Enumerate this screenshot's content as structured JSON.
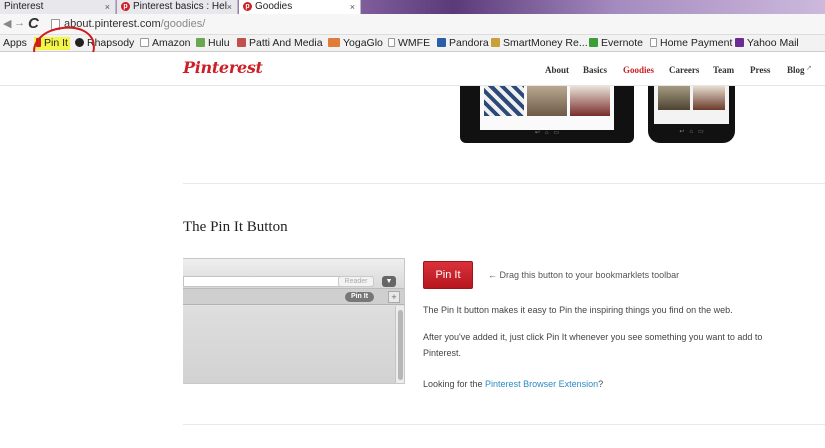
{
  "browser": {
    "tabs": [
      {
        "title": "Pinterest",
        "active": false
      },
      {
        "title": "Pinterest basics : Hel",
        "active": false
      },
      {
        "title": "Goodies",
        "active": true
      }
    ],
    "close_glyph": "×",
    "url_host": "about.pinterest.com",
    "url_path": "/goodies/",
    "bookmarks": [
      {
        "label": "Apps",
        "icon": "apps-icon",
        "color": "#4a7bd0"
      },
      {
        "label": "Pin It",
        "icon": "pin-icon",
        "color": "#cb2027",
        "highlighted": true
      },
      {
        "label": "Rhapsody",
        "icon": "rhapsody-icon",
        "color": "#222222"
      },
      {
        "label": "Amazon",
        "icon": "amazon-icon",
        "color": "#222222"
      },
      {
        "label": "Hulu",
        "icon": "hulu-icon",
        "color": "#6aa84f"
      },
      {
        "label": "Patti And Media",
        "icon": "patti-icon",
        "color": "#c0504d"
      },
      {
        "label": "YogaGlo",
        "icon": "yogaglo-icon",
        "color": "#e07b39"
      },
      {
        "label": "WMFE",
        "icon": "page-icon",
        "color": "#ffffff"
      },
      {
        "label": "Pandora",
        "icon": "pandora-icon",
        "color": "#2b5ea8"
      },
      {
        "label": "SmartMoney Re...",
        "icon": "smartmoney-icon",
        "color": "#c9a13b"
      },
      {
        "label": "Evernote",
        "icon": "evernote-icon",
        "color": "#3d9d3a"
      },
      {
        "label": "Home Payment",
        "icon": "page-icon",
        "color": "#ffffff"
      },
      {
        "label": "Yahoo Mail",
        "icon": "yahoo-icon",
        "color": "#6b2c91"
      }
    ]
  },
  "site": {
    "logo": "Pinterest",
    "nav": [
      "About",
      "Basics",
      "Goodies",
      "Careers",
      "Team",
      "Press",
      "Blog"
    ],
    "current": "Goodies",
    "brand_color": "#cb2027"
  },
  "section": {
    "title": "The Pin It Button",
    "illustration": {
      "reader_label": "Reader",
      "pin_label": "Pin It",
      "plus": "+"
    },
    "button_label": "Pin It",
    "drag_hint": "← Drag this button to your bookmarklets toolbar",
    "desc1": "The Pin It button makes it easy to Pin the inspiring things you find on the web.",
    "desc2": "After you've added it, just click Pin It whenever you see something you want to add to Pinterest.",
    "desc3_prefix": "Looking for the ",
    "desc3_link": "Pinterest Browser Extension",
    "desc3_suffix": "?"
  }
}
